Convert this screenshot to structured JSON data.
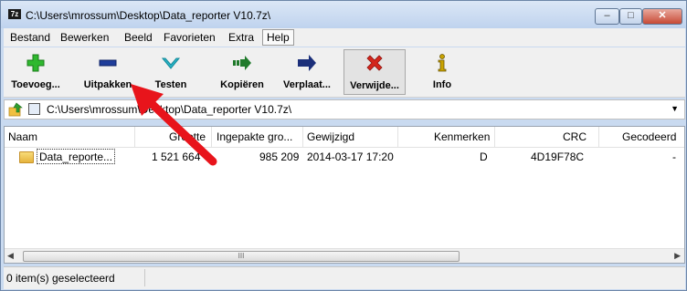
{
  "window": {
    "title": "C:\\Users\\mrossum\\Desktop\\Data_reporter V10.7z\\",
    "app_icon_text": "7z",
    "controls": {
      "minimize": "–",
      "maximize": "□",
      "close": "✕"
    }
  },
  "menu": {
    "items": [
      "Bestand",
      "Bewerken",
      "Beeld",
      "Favorieten",
      "Extra",
      "Help"
    ]
  },
  "toolbar": {
    "buttons": [
      {
        "label": "Toevoeg...",
        "icon": "plus-icon",
        "color": "#2fb82f"
      },
      {
        "label": "Uitpakken",
        "icon": "minus-icon",
        "color": "#1f3d9a"
      },
      {
        "label": "Testen",
        "icon": "check-icon",
        "color": "#2ab5c8"
      },
      {
        "label": "Kopiëren",
        "icon": "copy-arrow-icon",
        "color": "#1f7a2b"
      },
      {
        "label": "Verplaat...",
        "icon": "move-arrow-icon",
        "color": "#1b2f7a"
      },
      {
        "label": "Verwijde...",
        "icon": "delete-x-icon",
        "color": "#d4261c"
      },
      {
        "label": "Info",
        "icon": "info-icon",
        "color": "#c9a300"
      }
    ]
  },
  "address": {
    "path": "C:\\Users\\mrossum\\Desktop\\Data_reporter V10.7z\\"
  },
  "file_list": {
    "columns": [
      "Naam",
      "Grootte",
      "Ingepakte gro...",
      "Gewijzigd",
      "Kenmerken",
      "CRC",
      "Gecodeerd"
    ],
    "rows": [
      {
        "name": "Data_reporte...",
        "size": "1 521 664",
        "packed_size": "985 209",
        "modified": "2014-03-17 17:20",
        "attributes": "D",
        "crc": "4D19F78C",
        "encrypted": "-"
      }
    ],
    "scroll_thumb_grip": "III"
  },
  "status": {
    "selected_text": "0 item(s) geselecteerd"
  },
  "annotation": {
    "arrow_color": "#e8141b"
  }
}
